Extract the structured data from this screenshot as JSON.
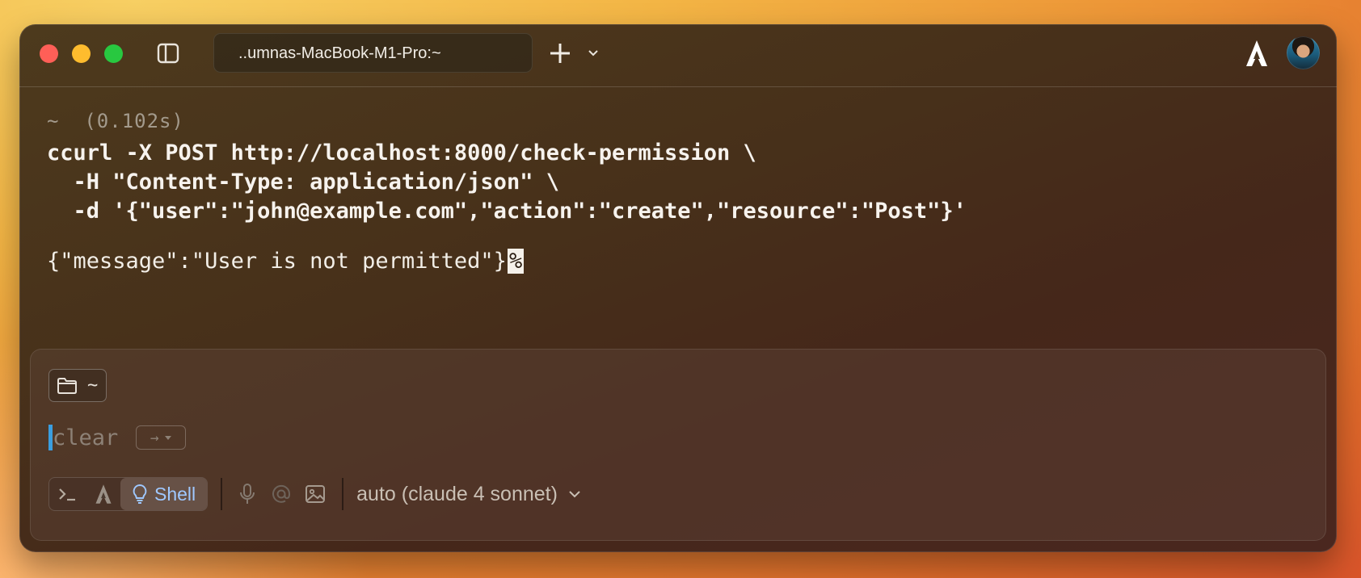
{
  "window": {
    "tab_title": "..umnas-MacBook-M1-Pro:~"
  },
  "block": {
    "meta": "~  (0.102s)",
    "command_lines": [
      "ccurl -X POST http://localhost:8000/check-permission \\",
      "  -H \"Content-Type: application/json\" \\",
      "  -d '{\"user\":\"john@example.com\",\"action\":\"create\",\"resource\":\"Post\"}'"
    ],
    "output": "{\"message\":\"User is not permitted\"}",
    "output_end_marker": "%"
  },
  "input": {
    "directory": "~",
    "suggestion": "clear",
    "accept_hint": "→"
  },
  "toolbar": {
    "active_mode": "Shell",
    "model": "auto (claude 4 sonnet)"
  },
  "colors": {
    "accent_blue": "#9fc8ff",
    "caret": "#3a9ee0"
  },
  "icons": [
    "sidebar-toggle-icon",
    "plus-icon",
    "chevron-down-icon",
    "agent-logo-icon",
    "folder-icon",
    "terminal-icon",
    "agent-mode-icon",
    "lightbulb-icon",
    "microphone-icon",
    "at-sign-icon",
    "image-icon"
  ]
}
